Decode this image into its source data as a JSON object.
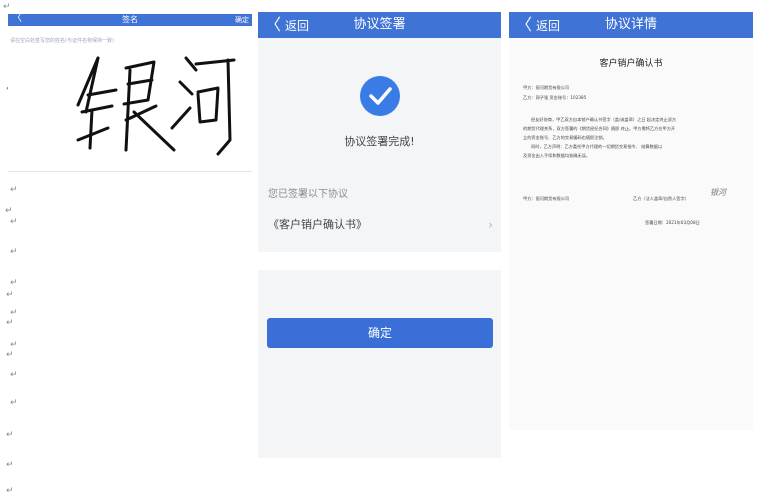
{
  "paragraph_marks": [
    "↵",
    "↵",
    "↵",
    "↵",
    "↵",
    "↵",
    "↵",
    "↵",
    "↵",
    "↵",
    "↵",
    "↵",
    "↵",
    "↵",
    "↵",
    "↵",
    "↵"
  ],
  "signature_screen": {
    "back_icon": "chevron-left-icon",
    "back_glyph": "〈",
    "title": "签名",
    "confirm_label": "确定",
    "hint": "请在空白处签写您的姓名(与证件名称保持一致)",
    "signature_text": "银河"
  },
  "complete_screen": {
    "back_glyph": "〈",
    "back_label": "返回",
    "title": "协议签署",
    "status_icon": "check-circle-icon",
    "status_text": "协议签署完成!",
    "signed_label": "您已签署以下协议",
    "doc_link": "《客户销户确认书》",
    "doc_chevron": "›",
    "confirm_button": "确定"
  },
  "details_screen": {
    "back_glyph": "〈",
    "back_label": "返回",
    "title": "协议详情",
    "doc_title": "客户销户确认书",
    "party_a": "甲方：银河期货有限公司",
    "party_b": "乙方：郭子强  资金账号：102385",
    "body": [
      "经友好协商，甲乙双方自本销户确认书签字（盖/或盖章）之日 起决定终止双方",
      "的期货代理关系，双方签署的《期货经纪合同》随即 终止。甲方需将乙方在甲方开",
      "立的资金账号、乙方的交易编码也随即注销。",
      "同时，乙方声明：乙方委托甲方代理的一切期货交易指令、 结算数据以",
      "及资金出入手续和数据均准确无误。"
    ],
    "sign_party_a": "甲方：银河期货有限公司",
    "sign_party_b": "乙方（法人盖章/自然人签字）",
    "sign_thumb": "银河",
    "sign_date": "签署日期：2021年03月08日"
  },
  "colors": {
    "brand_blue": "#3f73d6",
    "button_blue": "#3a6fd8",
    "check_blue": "#3a7ce6"
  }
}
